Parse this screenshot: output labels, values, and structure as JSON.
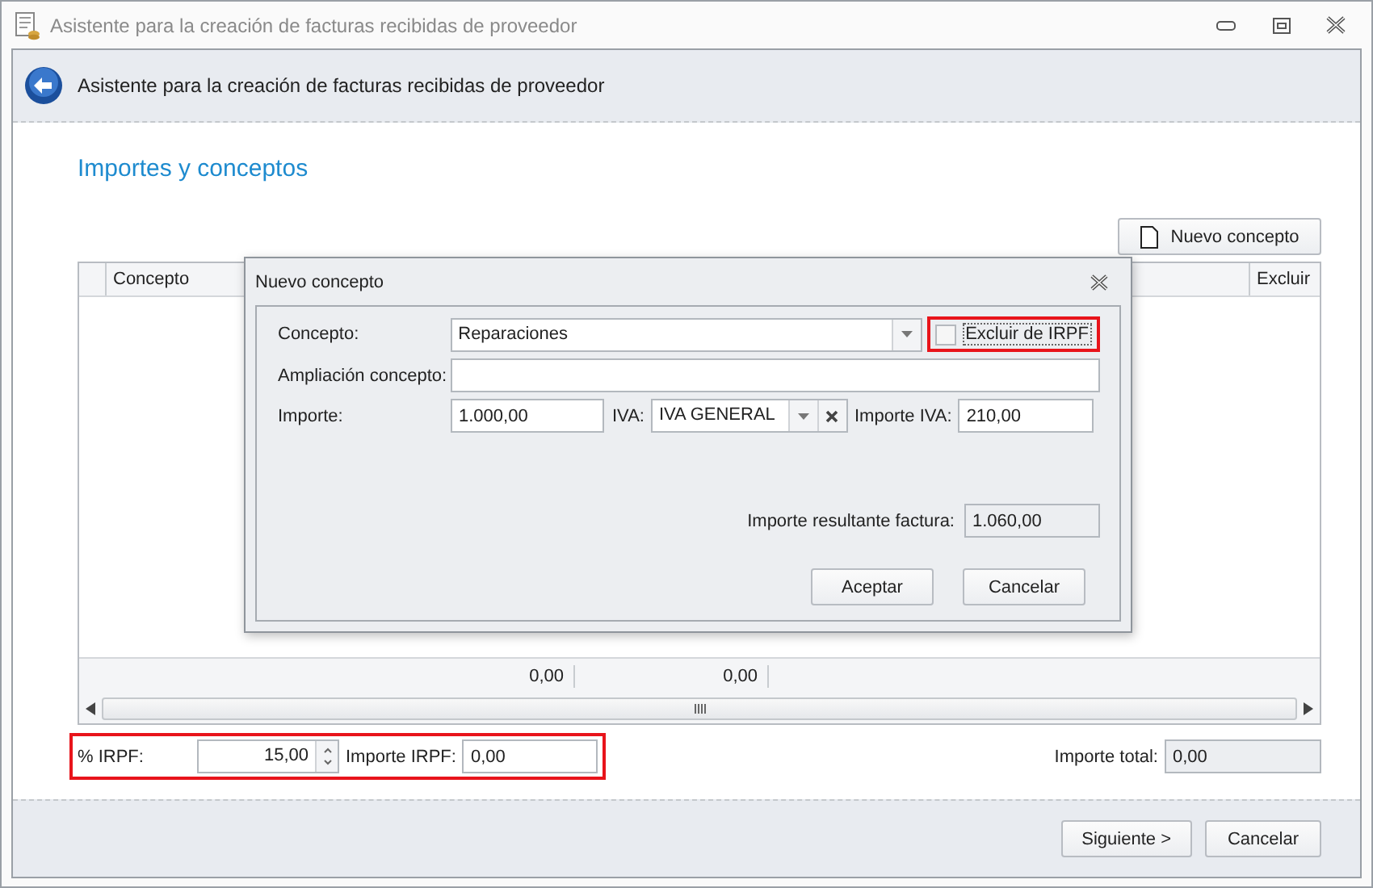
{
  "window": {
    "title": "Asistente para la creación de facturas recibidas de proveedor"
  },
  "header": {
    "title": "Asistente para la creación de facturas recibidas de proveedor"
  },
  "section_title": "Importes y conceptos",
  "toolbar": {
    "new_button": "Nuevo concepto"
  },
  "table": {
    "columns": [
      "Concepto",
      "Excluir"
    ],
    "totals": [
      "0,00",
      "0,00"
    ]
  },
  "irpf": {
    "highlighted": true,
    "percent_label": "% IRPF:",
    "percent_value": "15,00",
    "amount_label": "Importe IRPF:",
    "amount_value": "0,00"
  },
  "total": {
    "label": "Importe total:",
    "value": "0,00"
  },
  "buttons": [
    {
      "label": "Siguiente >"
    },
    {
      "label": "Cancelar"
    }
  ],
  "dialog": {
    "title": "Nuevo concepto",
    "concepto": {
      "label": "Concepto:",
      "value": "Reparaciones"
    },
    "exclude": {
      "label": "Excluir de IRPF",
      "checked": false,
      "highlighted": true
    },
    "ampliacion": {
      "label": "Ampliación concepto:"
    },
    "importe": {
      "label": "Importe:",
      "value": "1.000,00"
    },
    "iva": {
      "label": "IVA:",
      "value": "IVA GENERAL"
    },
    "importe_iva": {
      "label": "Importe IVA:",
      "value": "210,00"
    },
    "resultante": {
      "label": "Importe resultante factura:",
      "value": "1.060,00"
    },
    "buttons": [
      {
        "label": "Aceptar"
      },
      {
        "label": "Cancelar"
      }
    ]
  }
}
